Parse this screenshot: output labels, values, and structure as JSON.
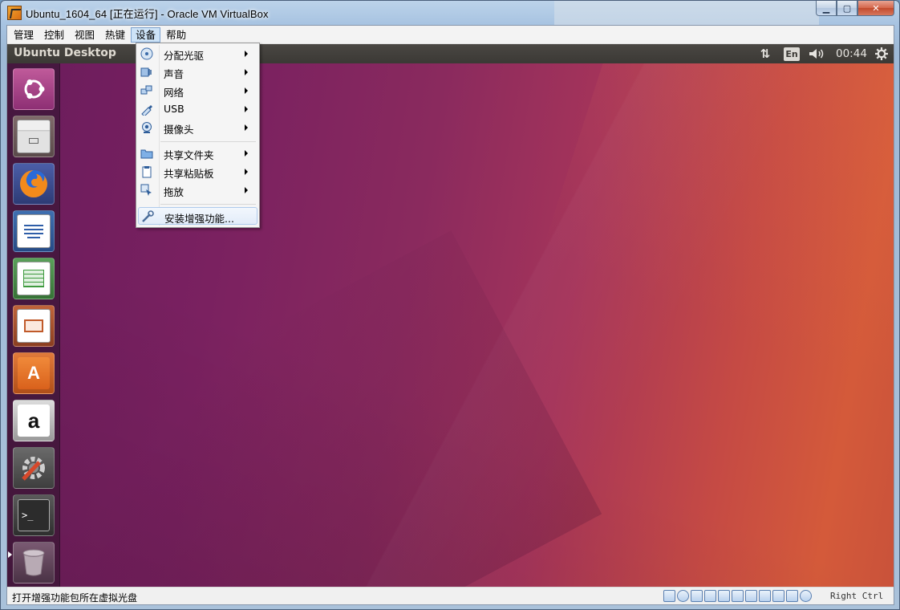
{
  "window": {
    "title": "Ubuntu_1604_64 [正在运行] - Oracle VM VirtualBox",
    "caption_buttons": [
      "minimize",
      "maximize",
      "close"
    ]
  },
  "menubar": {
    "items": [
      "管理",
      "控制",
      "视图",
      "热键",
      "设备",
      "帮助"
    ],
    "active_index": 4
  },
  "devices_menu": {
    "items": [
      {
        "label": "分配光驱",
        "icon": "optical-disc-icon",
        "submenu": true
      },
      {
        "label": "声音",
        "icon": "audio-icon",
        "submenu": true
      },
      {
        "label": "网络",
        "icon": "network-icon",
        "submenu": true
      },
      {
        "label": "USB",
        "icon": "usb-icon",
        "submenu": true
      },
      {
        "label": "摄像头",
        "icon": "webcam-icon",
        "submenu": true
      },
      {
        "label": "共享文件夹",
        "icon": "shared-folder-icon",
        "submenu": true
      },
      {
        "label": "共享粘贴板",
        "icon": "clipboard-icon",
        "submenu": true
      },
      {
        "label": "拖放",
        "icon": "drag-drop-icon",
        "submenu": true
      },
      {
        "label": "安装增强功能...",
        "icon": "guest-additions-icon",
        "submenu": false,
        "highlighted": true
      }
    ]
  },
  "guest": {
    "topbar_title": "Ubuntu Desktop",
    "language": "En",
    "clock": "00:44",
    "launcher": [
      {
        "name": "ubuntu-dash-icon"
      },
      {
        "name": "files-icon"
      },
      {
        "name": "firefox-icon"
      },
      {
        "name": "libreoffice-writer-icon"
      },
      {
        "name": "libreoffice-calc-icon"
      },
      {
        "name": "libreoffice-impress-icon"
      },
      {
        "name": "ubuntu-software-icon"
      },
      {
        "name": "amazon-icon"
      },
      {
        "name": "system-settings-icon"
      },
      {
        "name": "terminal-icon",
        "running": true
      },
      {
        "name": "trash-icon"
      }
    ],
    "colors": {
      "wallpaper_left": "#6a1c5c",
      "wallpaper_right": "#d45a3a",
      "topbar": "#3b3935"
    }
  },
  "statusbar": {
    "text": "打开增强功能包所在虚拟光盘",
    "host_key": "Right Ctrl"
  }
}
